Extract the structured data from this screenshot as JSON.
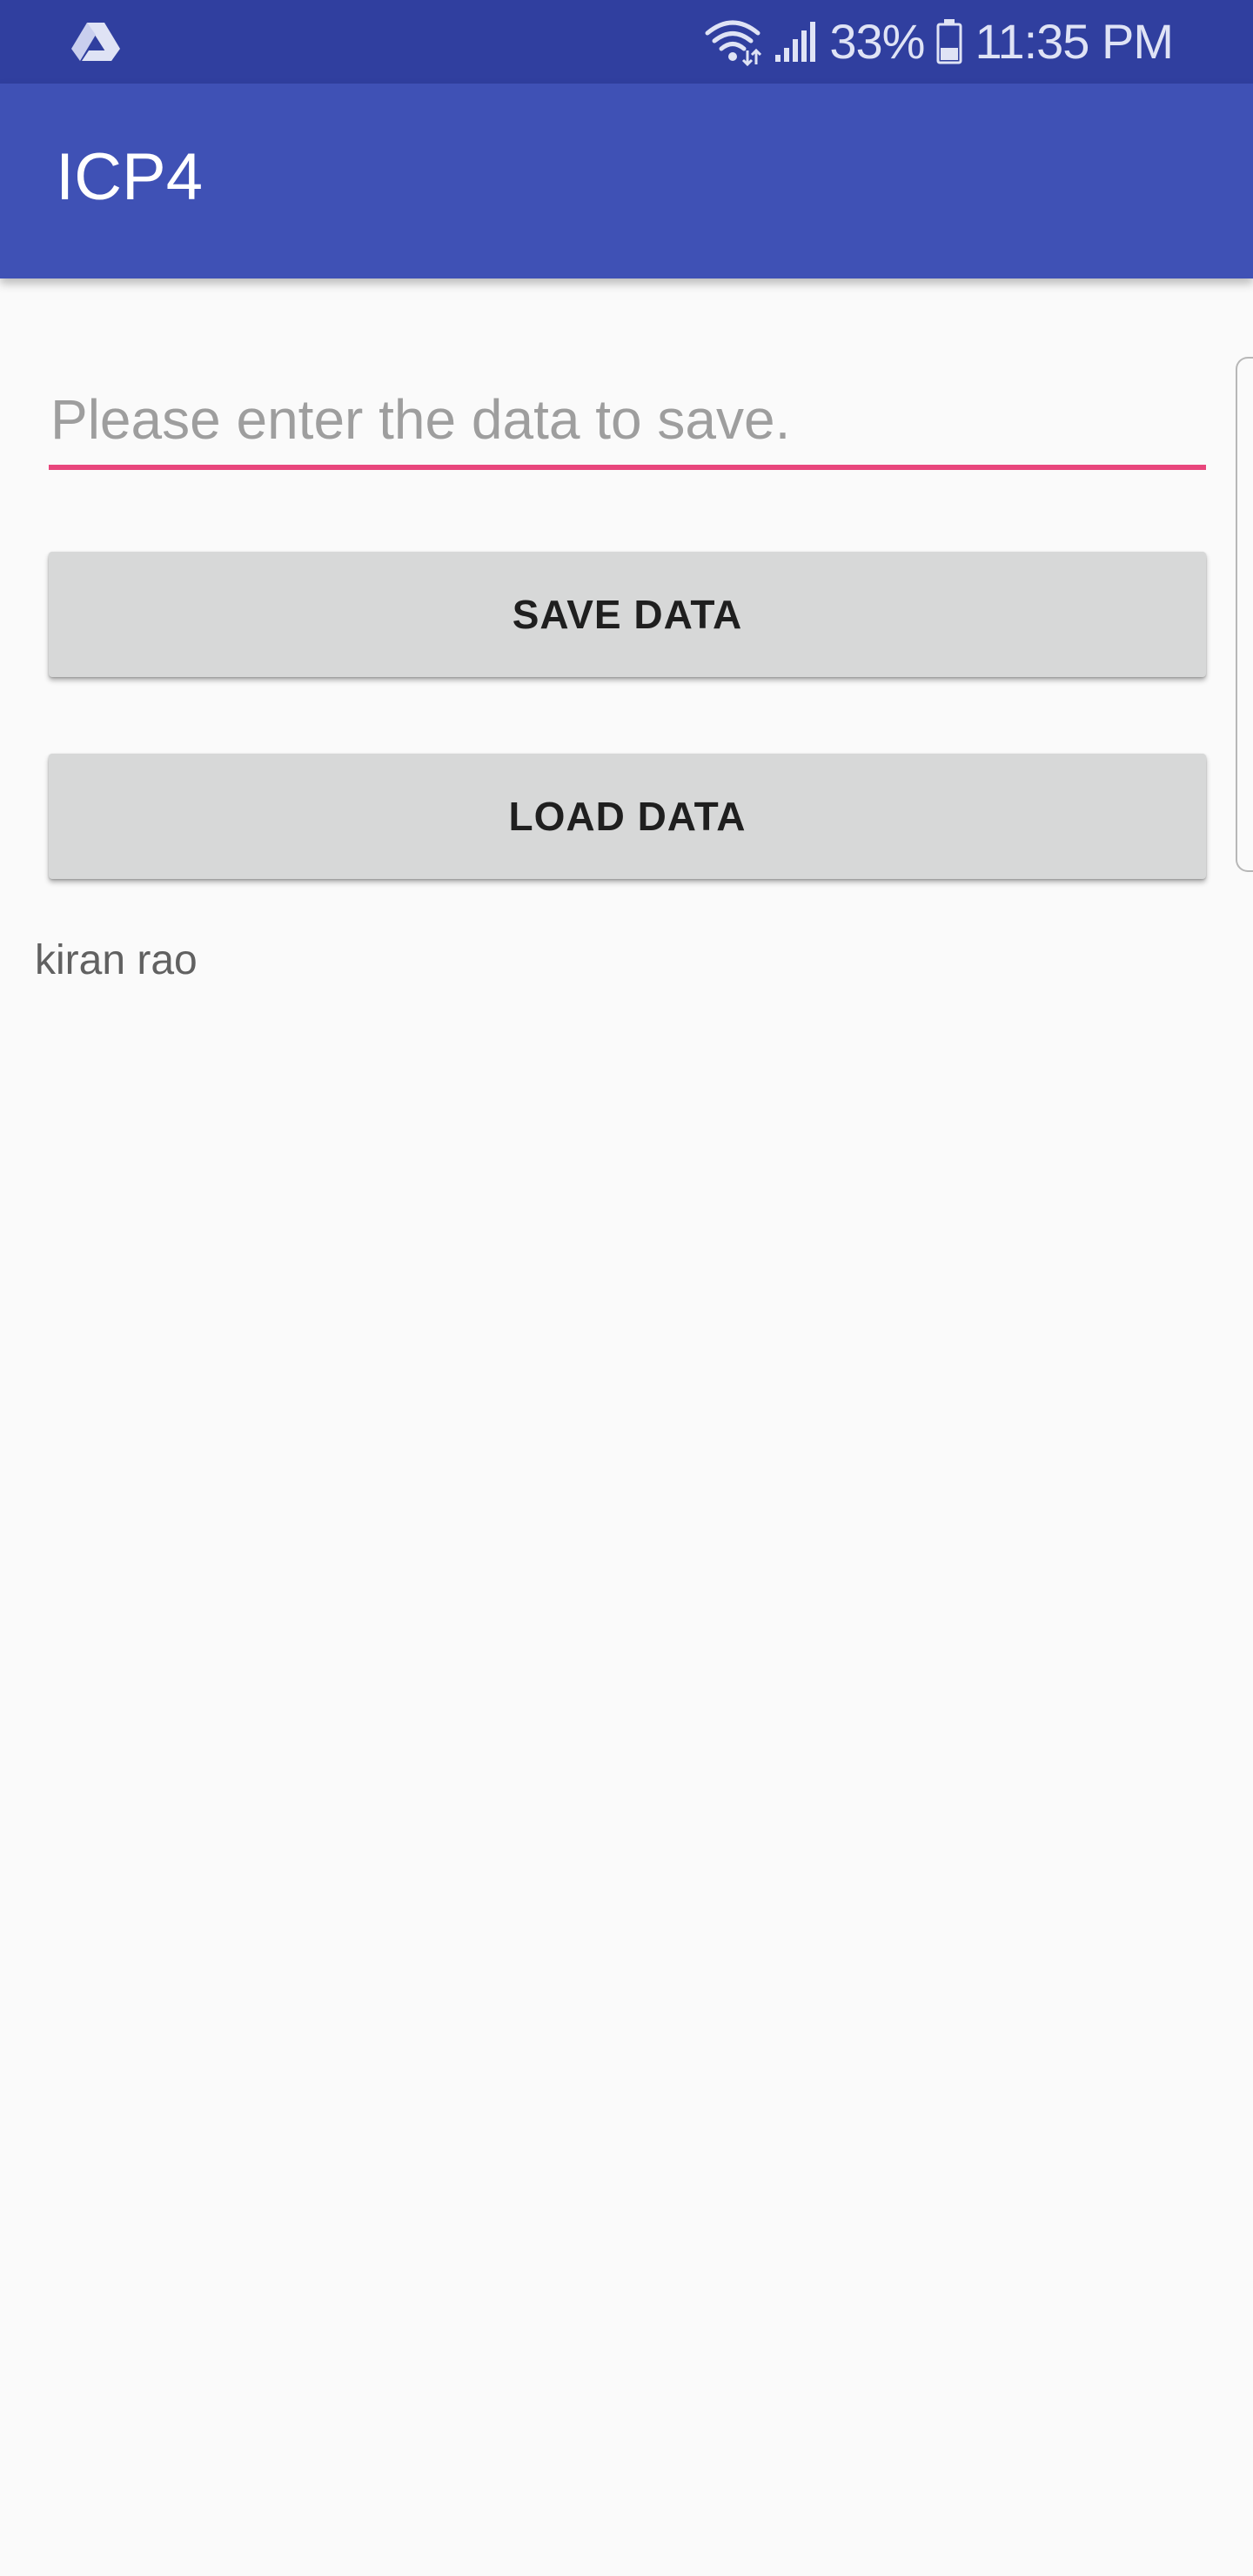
{
  "status_bar": {
    "left_icon": "drive-icon",
    "battery_percent": "33%",
    "time": "11:35 PM",
    "icons": [
      "wifi-icon",
      "signal-icon",
      "battery-icon"
    ]
  },
  "app_bar": {
    "title": "ICP4"
  },
  "form": {
    "input_value": "",
    "input_placeholder": "Please enter the data to save.",
    "save_label": "SAVE DATA",
    "load_label": "LOAD DATA"
  },
  "output": {
    "text": "kiran rao"
  },
  "colors": {
    "status_bar": "#303f9f",
    "app_bar": "#3f51b5",
    "accent": "#e8467c",
    "button": "#d7d8d8",
    "background": "#fafafa"
  }
}
